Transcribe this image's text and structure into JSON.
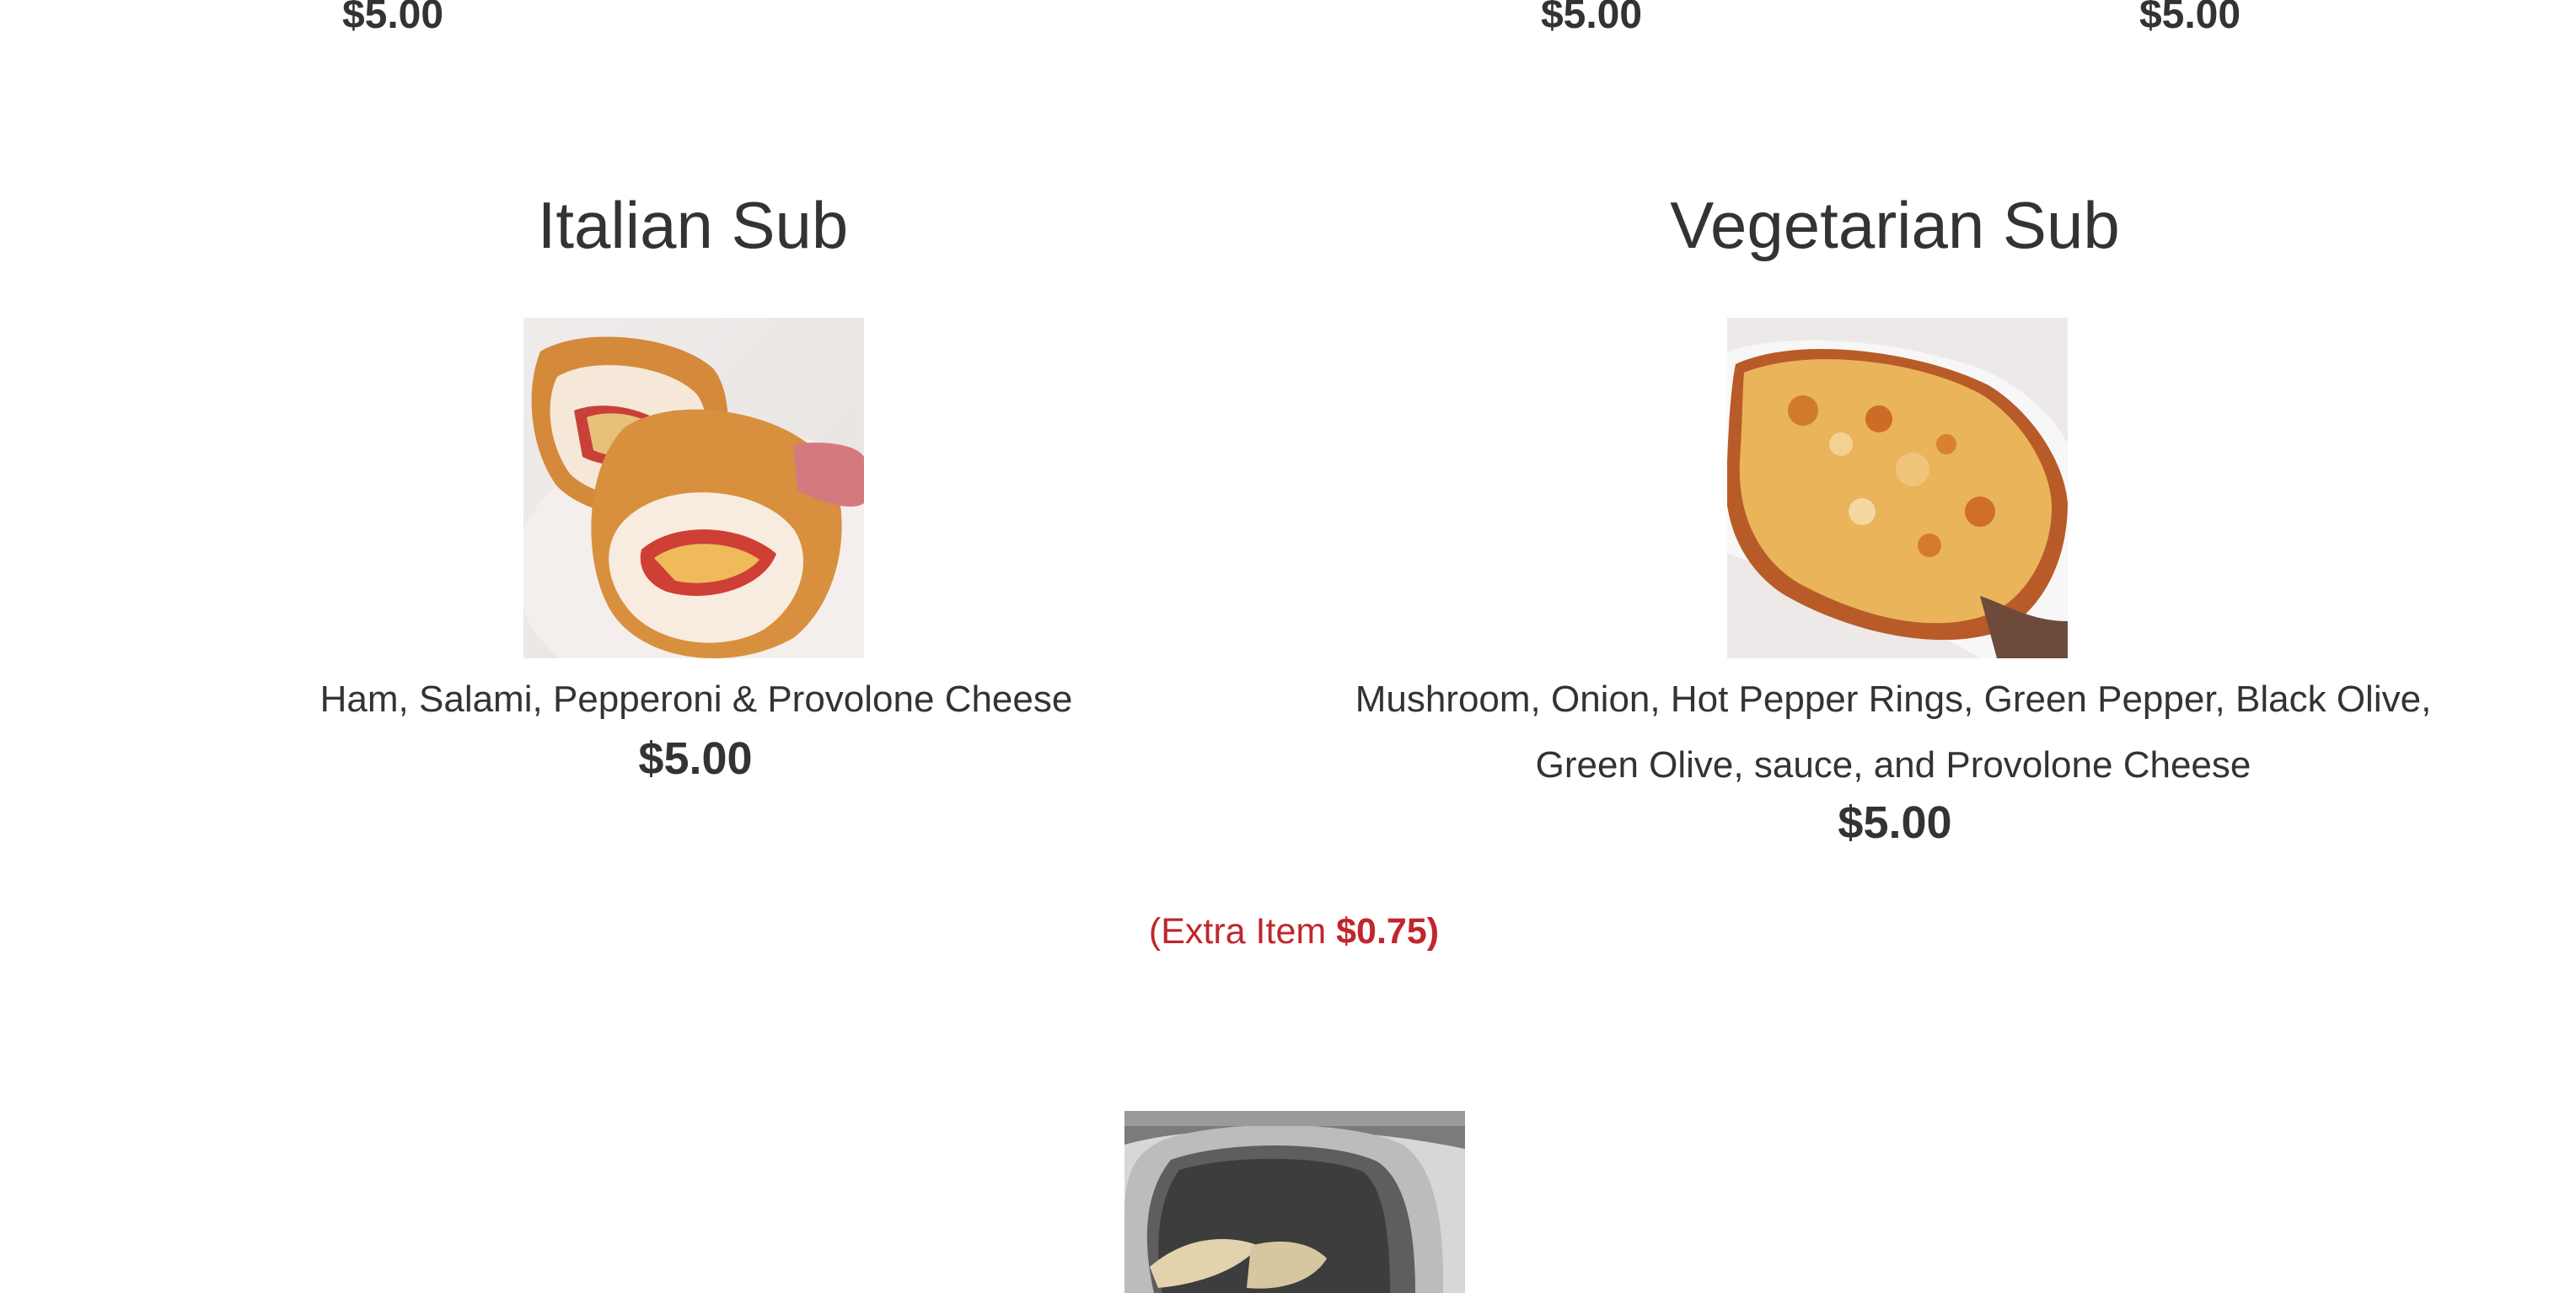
{
  "top_row_prices": [
    "$5.00",
    "$5.00",
    "$5.00"
  ],
  "items": [
    {
      "name": "Italian Sub",
      "description_lines": [
        "Ham, Salami, Pepperoni & Provolone Cheese"
      ],
      "price": "$5.00",
      "image_icon": "italian-sub-photo"
    },
    {
      "name": "Vegetarian Sub",
      "description_lines": [
        "Mushroom, Onion, Hot Pepper Rings, Green Pepper, Black Olive,",
        "Green Olive, sauce, and Provolone Cheese"
      ],
      "price": "$5.00",
      "image_icon": "vegetarian-sub-photo"
    }
  ],
  "extra_note": {
    "prefix": "(Extra Item ",
    "amount": "$0.75)"
  },
  "bottom_image_icon": "kitchen-equipment-photo",
  "colors": {
    "text": "#333333",
    "accent_red": "#c0262d",
    "background": "#ffffff"
  }
}
